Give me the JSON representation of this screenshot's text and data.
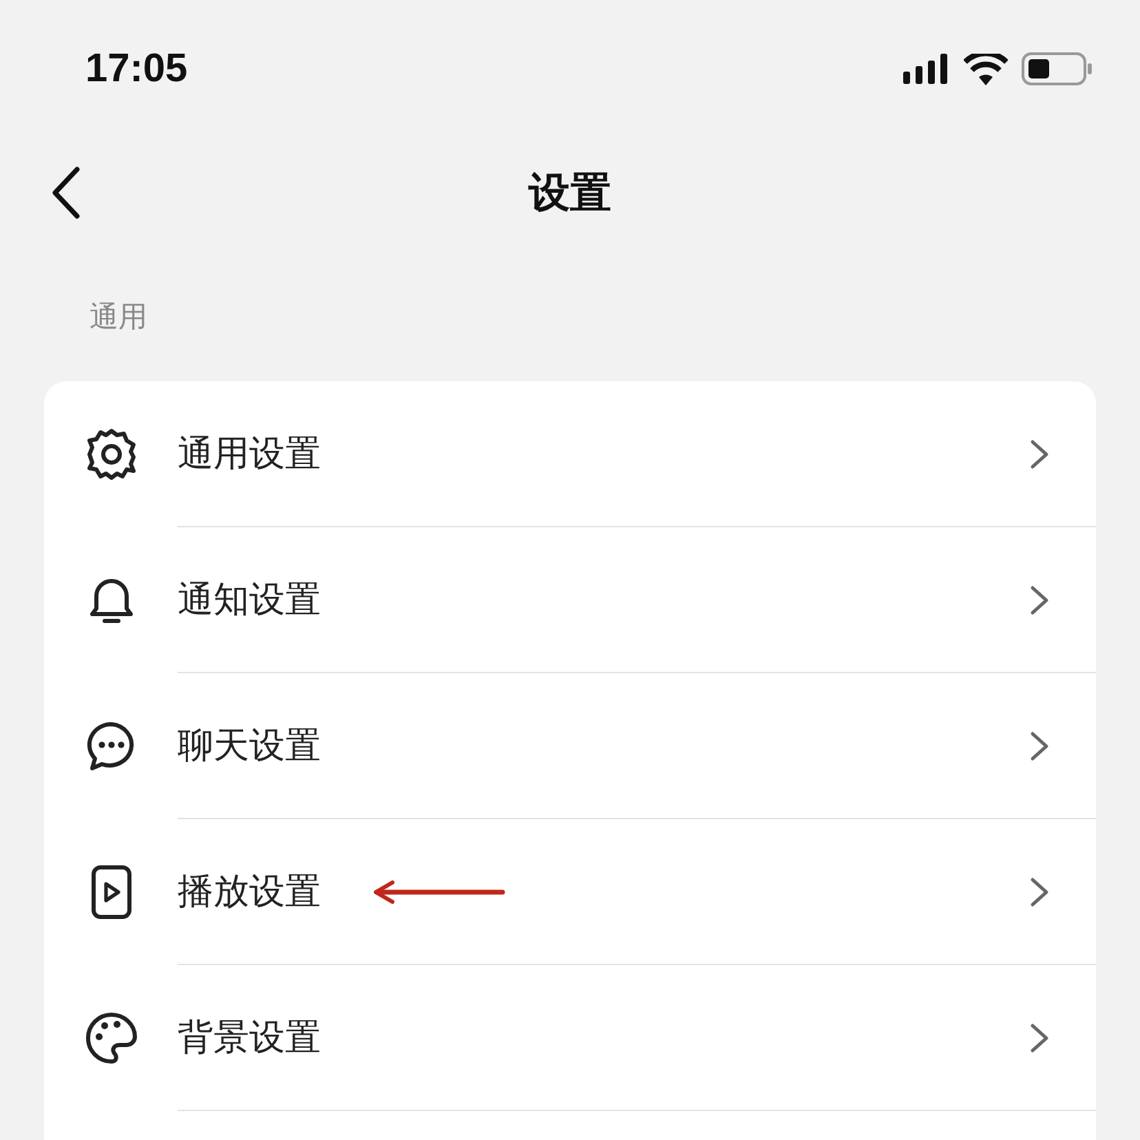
{
  "status_bar": {
    "time": "17:05"
  },
  "nav": {
    "title": "设置"
  },
  "section": {
    "title": "通用",
    "items": [
      {
        "label": "通用设置",
        "annotated": false
      },
      {
        "label": "通知设置",
        "annotated": false
      },
      {
        "label": "聊天设置",
        "annotated": false
      },
      {
        "label": "播放设置",
        "annotated": true
      },
      {
        "label": "背景设置",
        "annotated": false
      }
    ]
  }
}
